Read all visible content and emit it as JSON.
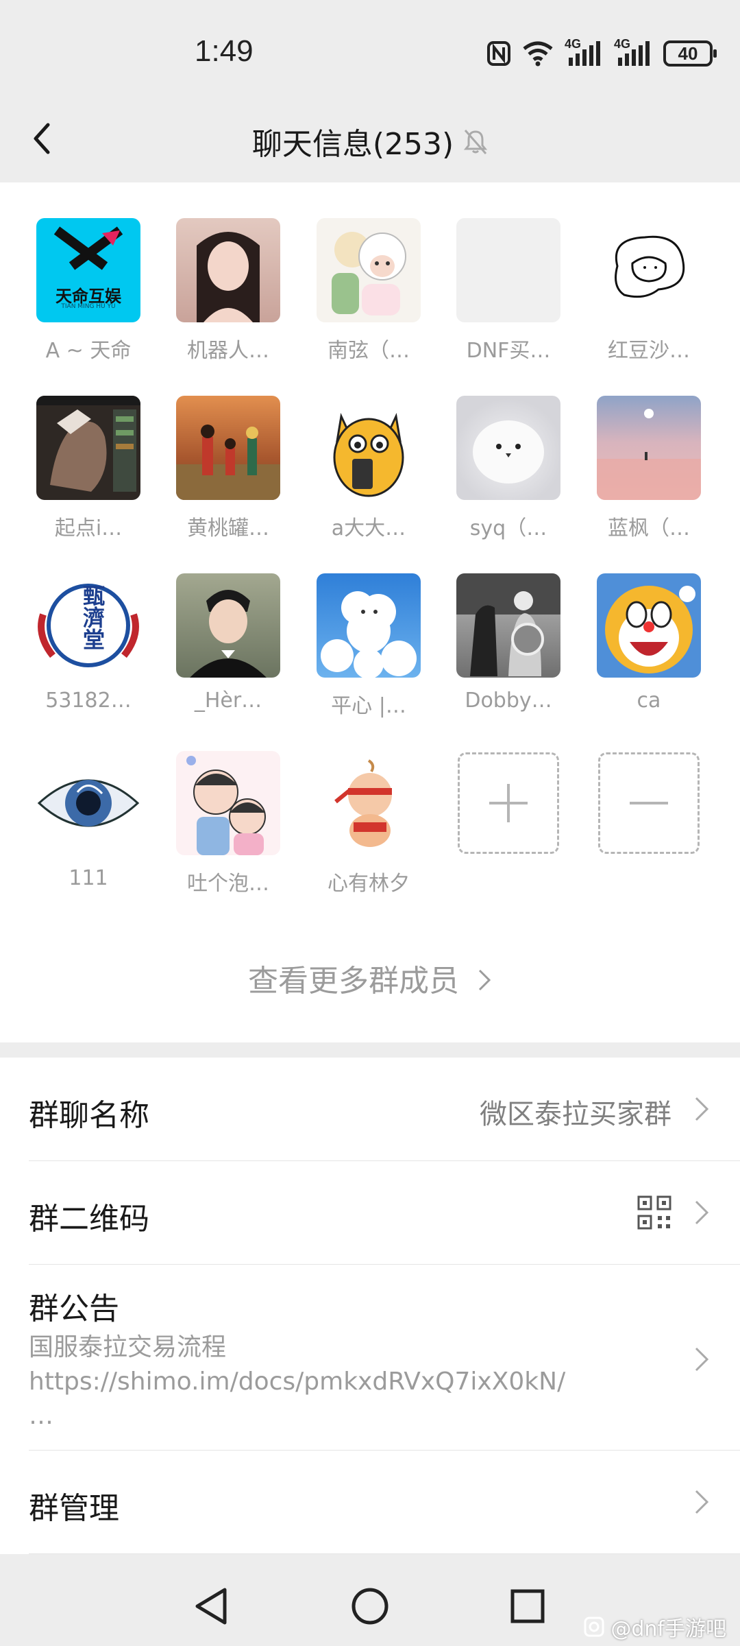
{
  "status_bar": {
    "time": "1:49",
    "battery": "40",
    "network_1": "4G",
    "network_2": "4G"
  },
  "header": {
    "title": "聊天信息(253)",
    "mute_icon": "bell-off-icon"
  },
  "members": [
    {
      "name": "A ~ 天命",
      "logo_text": "天命互娱",
      "logo_sub": "TIAN MING HU YU",
      "color": "#00c8f0"
    },
    {
      "name": "机器人…",
      "color": "#d9b7a8"
    },
    {
      "name": "南弦（…",
      "color": "#f4f1ea"
    },
    {
      "name": "DNF买…",
      "color": "#f0f0f0"
    },
    {
      "name": "红豆沙…",
      "color": "#ffffff"
    },
    {
      "name": "起点i…",
      "color": "#3a3430"
    },
    {
      "name": "黄桃罐…",
      "color": "#c77a45"
    },
    {
      "name": "a大大…",
      "color": "#ffffff"
    },
    {
      "name": "syq（…",
      "color": "#d8d8dc"
    },
    {
      "name": "蓝枫（…",
      "color": "#e9b9b7"
    },
    {
      "name": "53182…",
      "seal_text": "甄濟堂",
      "color": "#ffffff"
    },
    {
      "name": "_Hèr…",
      "color": "#9aa08a"
    },
    {
      "name": "平心 |…",
      "color": "#3d8be0"
    },
    {
      "name": "Dobby…",
      "color": "#8c8c8c"
    },
    {
      "name": "ca",
      "color": "#4f8fd8"
    },
    {
      "name": "111",
      "color": "#ffffff"
    },
    {
      "name": "吐个泡…",
      "color": "#fbeff0"
    },
    {
      "name": "心有林夕",
      "color": "#ffffff"
    }
  ],
  "more_members_label": "查看更多群成员",
  "settings": {
    "group_name_label": "群聊名称",
    "group_name_value": "微区泰拉买家群",
    "qr_label": "群二维码",
    "notice_label": "群公告",
    "notice_line1": "国服泰拉交易流程",
    "notice_line2": "https://shimo.im/docs/pmkxdRVxQ7ixX0kN/",
    "notice_line3": "…",
    "manage_label": "群管理"
  },
  "watermark": "@dnf手游吧"
}
